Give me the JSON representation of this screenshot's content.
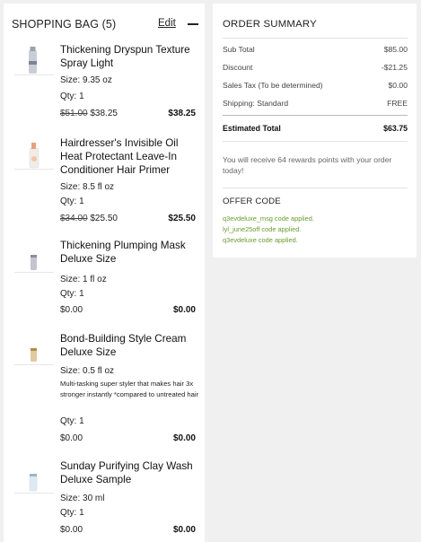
{
  "bag": {
    "title": "SHOPPING BAG (5)",
    "edit_label": "Edit",
    "items": [
      {
        "name": "Thickening Dryspun Texture Spray Light",
        "size": "Size: 9.35 oz",
        "qty": "Qty: 1",
        "original_price": "$51.00",
        "sale_price": "$38.25",
        "total": "$38.25"
      },
      {
        "name": "Hairdresser's Invisible Oil Heat Protectant Leave-In Conditioner Hair Primer",
        "size": "Size: 8.5 fl oz",
        "qty": "Qty: 1",
        "original_price": "$34.00",
        "sale_price": "$25.50",
        "total": "$25.50"
      },
      {
        "name": "Thickening Plumping Mask Deluxe Size",
        "size": "Size: 1 fl oz",
        "qty": "Qty: 1",
        "price": "$0.00",
        "total": "$0.00"
      },
      {
        "name": "Bond-Building Style Cream Deluxe Size",
        "size": "Size: 0.5 fl oz",
        "description": "Multi-tasking super styler that makes hair 3x stronger instantly *compared to untreated hair",
        "qty": "Qty: 1",
        "price": "$0.00",
        "total": "$0.00"
      },
      {
        "name": "Sunday Purifying Clay Wash Deluxe Sample",
        "size": "Size: 30 ml",
        "qty": "Qty: 1",
        "price": "$0.00",
        "total": "$0.00"
      }
    ]
  },
  "summary": {
    "title": "ORDER SUMMARY",
    "rows": [
      {
        "label": "Sub Total",
        "value": "$85.00"
      },
      {
        "label": "Discount",
        "value": "-$21.25"
      },
      {
        "label": "Sales Tax (To be determined)",
        "value": "$0.00"
      },
      {
        "label": "Shipping: Standard",
        "value": "FREE"
      }
    ],
    "estimated_label": "Estimated Total",
    "estimated_value": "$63.75",
    "rewards_text": "You will receive 64 rewards points with your order today!",
    "offer_title": "OFFER CODE",
    "offer_lines": [
      "q3evdeluxe_msg code applied.",
      "lyl_june25off code applied.",
      "q3evdeluxe code applied."
    ]
  },
  "colors": {
    "offer_applied": "#6a9c2f",
    "page_bg": "#f0f0f0"
  },
  "icons": [
    "collapse-minus-icon"
  ]
}
